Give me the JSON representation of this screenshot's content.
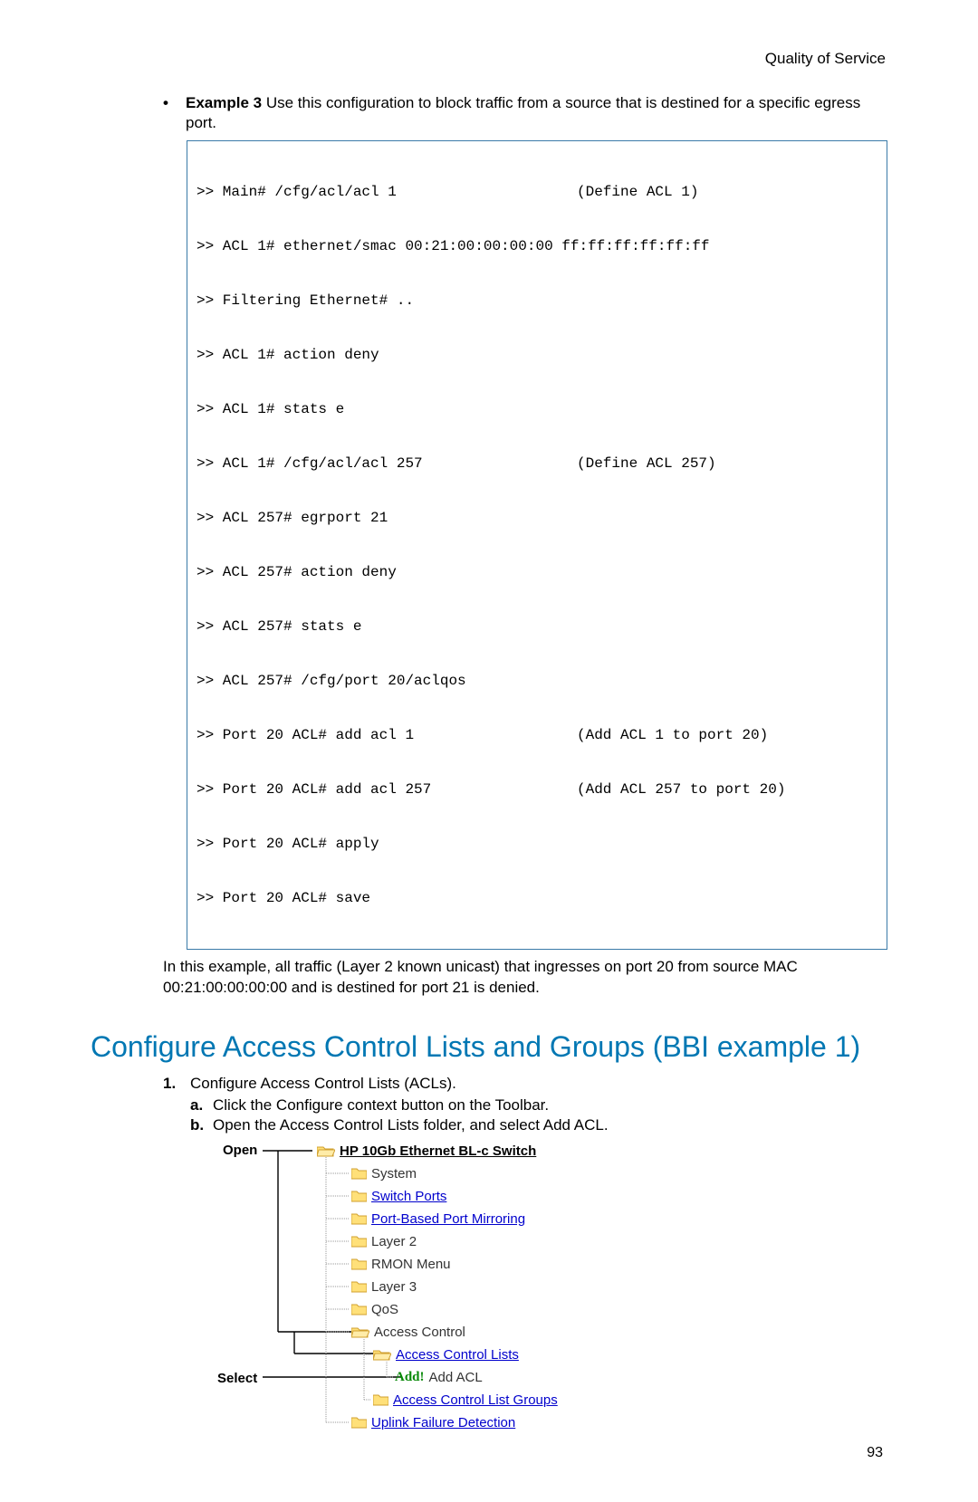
{
  "header": {
    "title": "Quality of Service"
  },
  "page_number": "93",
  "example": {
    "label": "Example 3",
    "intro": " Use this configuration to block traffic from a source that is destined for a specific egress port."
  },
  "code": {
    "lines": [
      {
        "left": ">> Main# /cfg/acl/acl 1",
        "right": "(Define ACL 1)"
      },
      {
        "left": ">> ACL 1# ethernet/smac 00:21:00:00:00:00 ff:ff:ff:ff:ff:ff",
        "right": ""
      },
      {
        "left": ">> Filtering Ethernet# ..",
        "right": ""
      },
      {
        "left": ">> ACL 1# action deny",
        "right": ""
      },
      {
        "left": ">> ACL 1# stats e",
        "right": ""
      },
      {
        "left": ">> ACL 1# /cfg/acl/acl 257",
        "right": "(Define ACL 257)"
      },
      {
        "left": ">> ACL 257# egrport 21",
        "right": ""
      },
      {
        "left": ">> ACL 257# action deny",
        "right": ""
      },
      {
        "left": ">> ACL 257# stats e",
        "right": ""
      },
      {
        "left": ">> ACL 257# /cfg/port 20/aclqos",
        "right": ""
      },
      {
        "left": ">> Port 20 ACL# add acl 1",
        "right": "(Add ACL 1 to port 20)"
      },
      {
        "left": ">> Port 20 ACL# add acl 257",
        "right": "(Add ACL 257 to port 20)"
      },
      {
        "left": ">> Port 20 ACL# apply",
        "right": ""
      },
      {
        "left": ">> Port 20 ACL# save",
        "right": ""
      }
    ]
  },
  "post_para": "In this example, all traffic (Layer 2 known unicast) that ingresses on port 20 from source MAC 00:21:00:00:00:00 and is destined for port 21 is denied.",
  "section_heading": "Configure Access Control Lists and Groups (BBI example 1)",
  "steps": {
    "s1": {
      "marker": "1.",
      "text": "Configure Access Control Lists (ACLs)."
    },
    "a": {
      "marker": "a.",
      "pre": "Click the ",
      "bold": "Configure",
      "post": " context button on the Toolbar."
    },
    "b": {
      "marker": "b.",
      "pre": "Open the Access Control Lists folder, and select ",
      "bold": "Add ACL",
      "post": "."
    }
  },
  "callouts": {
    "open": "Open",
    "select": "Select"
  },
  "tree": {
    "root": "HP 10Gb Ethernet BL-c Switch",
    "items": {
      "system": "System",
      "switch_ports": "Switch Ports",
      "port_mirror": "Port-Based Port Mirroring",
      "layer2": "Layer 2",
      "rmon": "RMON Menu",
      "layer3": "Layer 3",
      "qos": "QoS",
      "access_control": "Access Control",
      "acl": "Access Control Lists",
      "add_acl_cmd": "Add!",
      "add_acl_label": "Add ACL",
      "acl_groups": "Access Control List Groups",
      "uplink": "Uplink Failure Detection"
    }
  }
}
